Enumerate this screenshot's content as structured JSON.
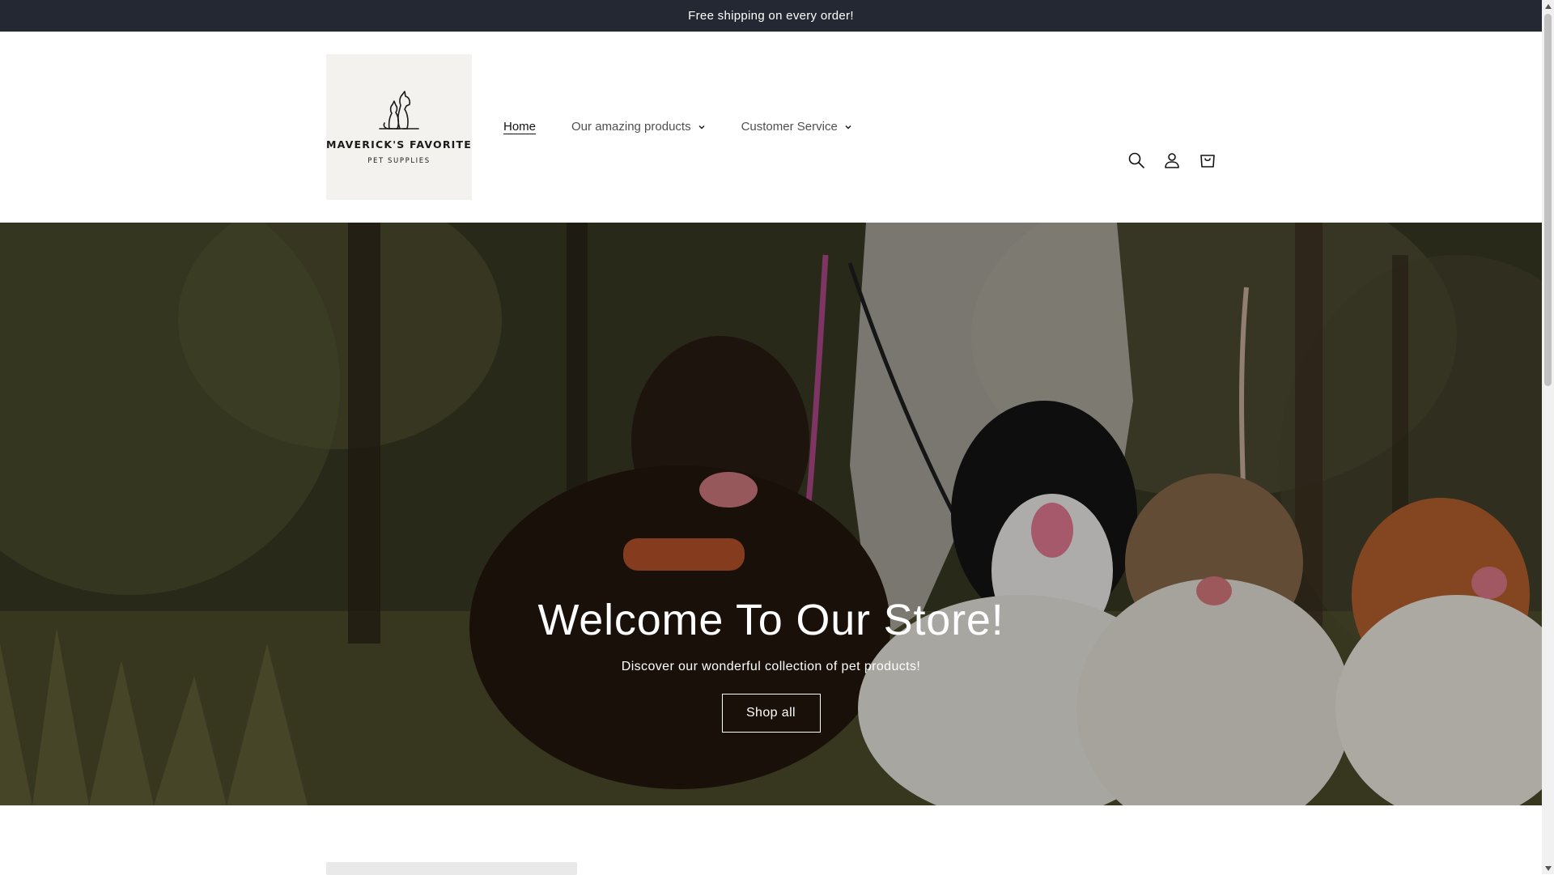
{
  "announcement": {
    "text": "Free shipping on every order!"
  },
  "logo": {
    "title": "MAVERICK'S FAVORITE",
    "subtitle": "PET SUPPLIES",
    "icon": "cat-dog-silhouette-icon"
  },
  "nav": {
    "items": [
      {
        "label": "Home",
        "active": true
      },
      {
        "label": "Our amazing products",
        "has_dropdown": true
      },
      {
        "label": "Customer Service",
        "has_dropdown": true
      }
    ]
  },
  "header_icons": [
    "search-icon",
    "account-icon",
    "cart-icon"
  ],
  "hero": {
    "title": "Welcome To Our Store!",
    "subtitle": "Discover our wonderful collection of pet products!",
    "button_label": "Shop all"
  },
  "colors": {
    "announcement_bg": "#242833",
    "text": "#121212",
    "hero_text": "#ffffff"
  }
}
